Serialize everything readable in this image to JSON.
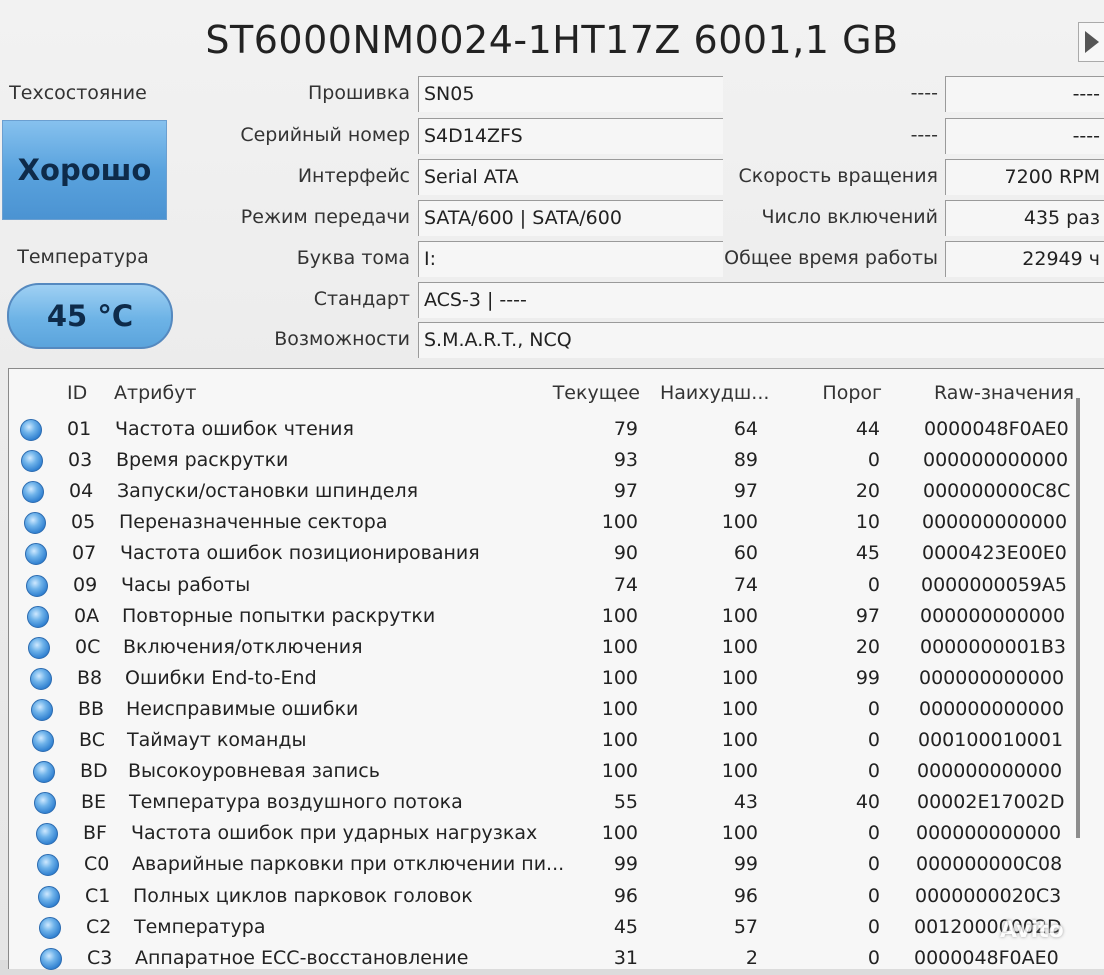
{
  "title": "ST6000NM0024-1HT17Z 6001,1 GB",
  "health": {
    "label": "Техсостояние",
    "value": "Хорошо"
  },
  "temperature": {
    "label": "Температура",
    "value": "45 °C"
  },
  "info": {
    "firmware": {
      "label": "Прошивка",
      "value": "SN05"
    },
    "serial": {
      "label": "Серийный номер",
      "value": "S4D14ZFS"
    },
    "interface": {
      "label": "Интерфейс",
      "value": "Serial ATA"
    },
    "transfer_mode": {
      "label": "Режим передачи",
      "value": "SATA/600 | SATA/600"
    },
    "drive_letter": {
      "label": "Буква тома",
      "value": "I:"
    },
    "standard": {
      "label": "Стандарт",
      "value": "ACS-3 | ----"
    },
    "features": {
      "label": "Возможности",
      "value": "S.M.A.R.T., NCQ"
    }
  },
  "right_info": {
    "row1": {
      "label": "----",
      "value": "----"
    },
    "row2": {
      "label": "----",
      "value": "----"
    },
    "rotation": {
      "label": "Скорость вращения",
      "value": "7200 RPM"
    },
    "power_count": {
      "label": "Число включений",
      "value": "435 раз"
    },
    "power_hours": {
      "label": "Общее время работы",
      "value": "22949 ч"
    }
  },
  "table": {
    "headers": {
      "id": "ID",
      "attr": "Атрибут",
      "current": "Текущее",
      "worst": "Наихудш...",
      "threshold": "Порог",
      "raw": "Raw-значения"
    },
    "rows": [
      {
        "id": "01",
        "name": "Частота ошибок чтения",
        "cur": "79",
        "worst": "64",
        "thr": "44",
        "raw": "0000048F0AE0"
      },
      {
        "id": "03",
        "name": "Время раскрутки",
        "cur": "93",
        "worst": "89",
        "thr": "0",
        "raw": "000000000000"
      },
      {
        "id": "04",
        "name": "Запуски/остановки шпинделя",
        "cur": "97",
        "worst": "97",
        "thr": "20",
        "raw": "000000000C8C"
      },
      {
        "id": "05",
        "name": "Переназначенные сектора",
        "cur": "100",
        "worst": "100",
        "thr": "10",
        "raw": "000000000000"
      },
      {
        "id": "07",
        "name": "Частота ошибок позиционирования",
        "cur": "90",
        "worst": "60",
        "thr": "45",
        "raw": "0000423E00E0"
      },
      {
        "id": "09",
        "name": "Часы работы",
        "cur": "74",
        "worst": "74",
        "thr": "0",
        "raw": "0000000059A5"
      },
      {
        "id": "0A",
        "name": "Повторные попытки раскрутки",
        "cur": "100",
        "worst": "100",
        "thr": "97",
        "raw": "000000000000"
      },
      {
        "id": "0C",
        "name": "Включения/отключения",
        "cur": "100",
        "worst": "100",
        "thr": "20",
        "raw": "0000000001B3"
      },
      {
        "id": "B8",
        "name": "Ошибки End-to-End",
        "cur": "100",
        "worst": "100",
        "thr": "99",
        "raw": "000000000000"
      },
      {
        "id": "BB",
        "name": "Неисправимые ошибки",
        "cur": "100",
        "worst": "100",
        "thr": "0",
        "raw": "000000000000"
      },
      {
        "id": "BC",
        "name": "Таймаут команды",
        "cur": "100",
        "worst": "100",
        "thr": "0",
        "raw": "000100010001"
      },
      {
        "id": "BD",
        "name": "Высокоуровневая запись",
        "cur": "100",
        "worst": "100",
        "thr": "0",
        "raw": "000000000000"
      },
      {
        "id": "BE",
        "name": "Температура воздушного потока",
        "cur": "55",
        "worst": "43",
        "thr": "40",
        "raw": "00002E17002D"
      },
      {
        "id": "BF",
        "name": "Частота ошибок при ударных нагрузках",
        "cur": "100",
        "worst": "100",
        "thr": "0",
        "raw": "000000000000"
      },
      {
        "id": "C0",
        "name": "Аварийные парковки при отключении пи...",
        "cur": "99",
        "worst": "99",
        "thr": "0",
        "raw": "000000000C08"
      },
      {
        "id": "C1",
        "name": "Полных циклов парковок головок",
        "cur": "96",
        "worst": "96",
        "thr": "0",
        "raw": "0000000020C3"
      },
      {
        "id": "C2",
        "name": "Температура",
        "cur": "45",
        "worst": "57",
        "thr": "0",
        "raw": "00120000002D"
      },
      {
        "id": "C3",
        "name": "Аппаратное ECC-восстановление",
        "cur": "31",
        "worst": "2",
        "thr": "0",
        "raw": "0000048F0AE0"
      }
    ]
  },
  "watermark": "Avito"
}
